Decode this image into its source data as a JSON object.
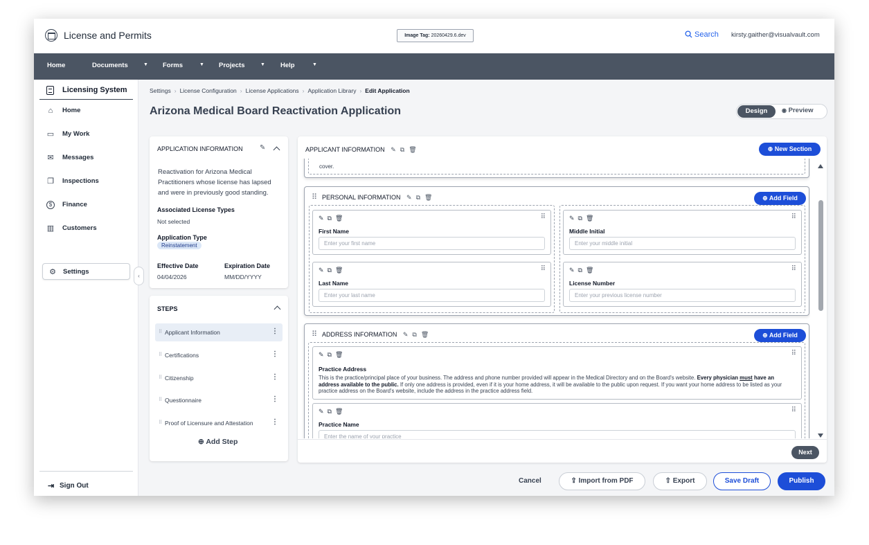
{
  "app": {
    "title": "License and Permits",
    "image_tag_label": "Image Tag:",
    "image_tag_value": "20260429.6.dev",
    "search_label": "Search",
    "user_email": "kirsty.gaither@visualvault.com"
  },
  "nav": {
    "home": "Home",
    "documents": "Documents",
    "forms": "Forms",
    "projects": "Projects",
    "help": "Help"
  },
  "sidebar": {
    "header": "Licensing System",
    "items": [
      {
        "label": "Home",
        "icon": "home-icon"
      },
      {
        "label": "My Work",
        "icon": "inbox-icon"
      },
      {
        "label": "Messages",
        "icon": "mail-icon"
      },
      {
        "label": "Inspections",
        "icon": "clipboard-icon"
      },
      {
        "label": "Finance",
        "icon": "dollar-icon"
      },
      {
        "label": "Customers",
        "icon": "building-icon"
      },
      {
        "label": "Settings",
        "icon": "gear-icon"
      }
    ],
    "sign_out": "Sign Out"
  },
  "breadcrumb": [
    "Settings",
    "License Configuration",
    "License Applications",
    "Application Library",
    "Edit Application"
  ],
  "page_title": "Arizona Medical Board Reactivation Application",
  "view_toggle": {
    "design": "Design",
    "preview": "Preview"
  },
  "app_info": {
    "title": "APPLICATION INFORMATION",
    "description": "Reactivation for Arizona Medical Practitioners whose license has lapsed and were in previously good standing.",
    "license_types_label": "Associated License Types",
    "license_types_value": "Not selected",
    "app_type_label": "Application Type",
    "app_type_value": "Reinstatement",
    "effective_label": "Effective Date",
    "effective_value": "04/04/2026",
    "expiration_label": "Expiration Date",
    "expiration_value": "MM/DD/YYYY"
  },
  "steps": {
    "title": "STEPS",
    "items": [
      "Applicant Information",
      "Certifications",
      "Citizenship",
      "Questionnaire",
      "Proof of Licensure and Attestation"
    ],
    "add_step": "Add Step"
  },
  "editor": {
    "section_title": "APPLICANT INFORMATION",
    "new_section": "New Section",
    "cover_text": "cover.",
    "personal": {
      "title": "PERSONAL INFORMATION",
      "add_field": "Add Field",
      "fields": [
        {
          "label": "First Name",
          "placeholder": "Enter your first name"
        },
        {
          "label": "Middle Initial",
          "placeholder": "Enter your middle initial"
        },
        {
          "label": "Last Name",
          "placeholder": "Enter your last name"
        },
        {
          "label": "License Number",
          "placeholder": "Enter your previous license number"
        }
      ]
    },
    "address": {
      "title": "ADDRESS INFORMATION",
      "add_field": "Add Field",
      "practice_address_label": "Practice Address",
      "help_1": "This is the practice/principal place of your business. The address and phone number provided will appear in the Medical Directory and on the Board's website.",
      "help_bold_1": "Every physician",
      "help_bold_2": "must",
      "help_bold_3": "have an address available to the public.",
      "help_2": "If only one address is provided, even if it is your home address, it will be available to the public upon request. If you want your home address to be listed as your practice address on the Board's website, include the address in the practice address field.",
      "practice_name_label": "Practice Name",
      "practice_name_placeholder": "Enter the name of your practice"
    },
    "next": "Next"
  },
  "footer": {
    "cancel": "Cancel",
    "import_pdf": "Import from PDF",
    "export": "Export",
    "save_draft": "Save Draft",
    "publish": "Publish"
  },
  "colors": {
    "nav_bg": "#4b5563",
    "accent": "#1d4ed8",
    "page_bg": "#f4f5f7"
  }
}
